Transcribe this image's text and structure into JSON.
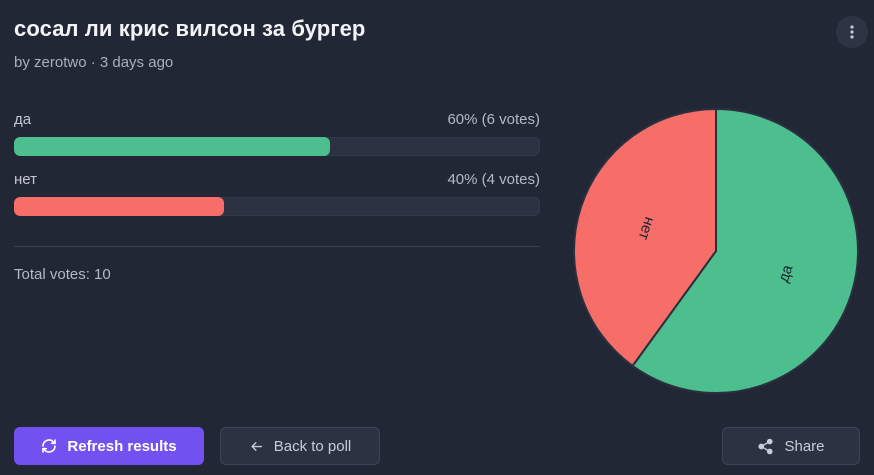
{
  "poll": {
    "title": "сосал ли крис вилсон за бургер",
    "meta": "by zerotwo · 3 days ago",
    "total_votes": "Total votes: 10"
  },
  "options": [
    {
      "label": "да",
      "result": "60% (6 votes)",
      "fraction": 0.6,
      "color": "#4dbf8e"
    },
    {
      "label": "нет",
      "result": "40% (4 votes)",
      "fraction": 0.4,
      "color": "#f76e68"
    }
  ],
  "actions": {
    "refresh_label": "Refresh results",
    "back_label": "Back to poll",
    "share_label": "Share"
  },
  "icons": {
    "menu": "more-vertical-icon",
    "refresh": "refresh-icon",
    "back": "arrow-left-icon",
    "share": "share-icon"
  },
  "chart_data": {
    "type": "pie",
    "categories": [
      "да",
      "нет"
    ],
    "values": [
      6,
      4
    ],
    "colors": [
      "#4dbf8e",
      "#f76e68"
    ]
  }
}
